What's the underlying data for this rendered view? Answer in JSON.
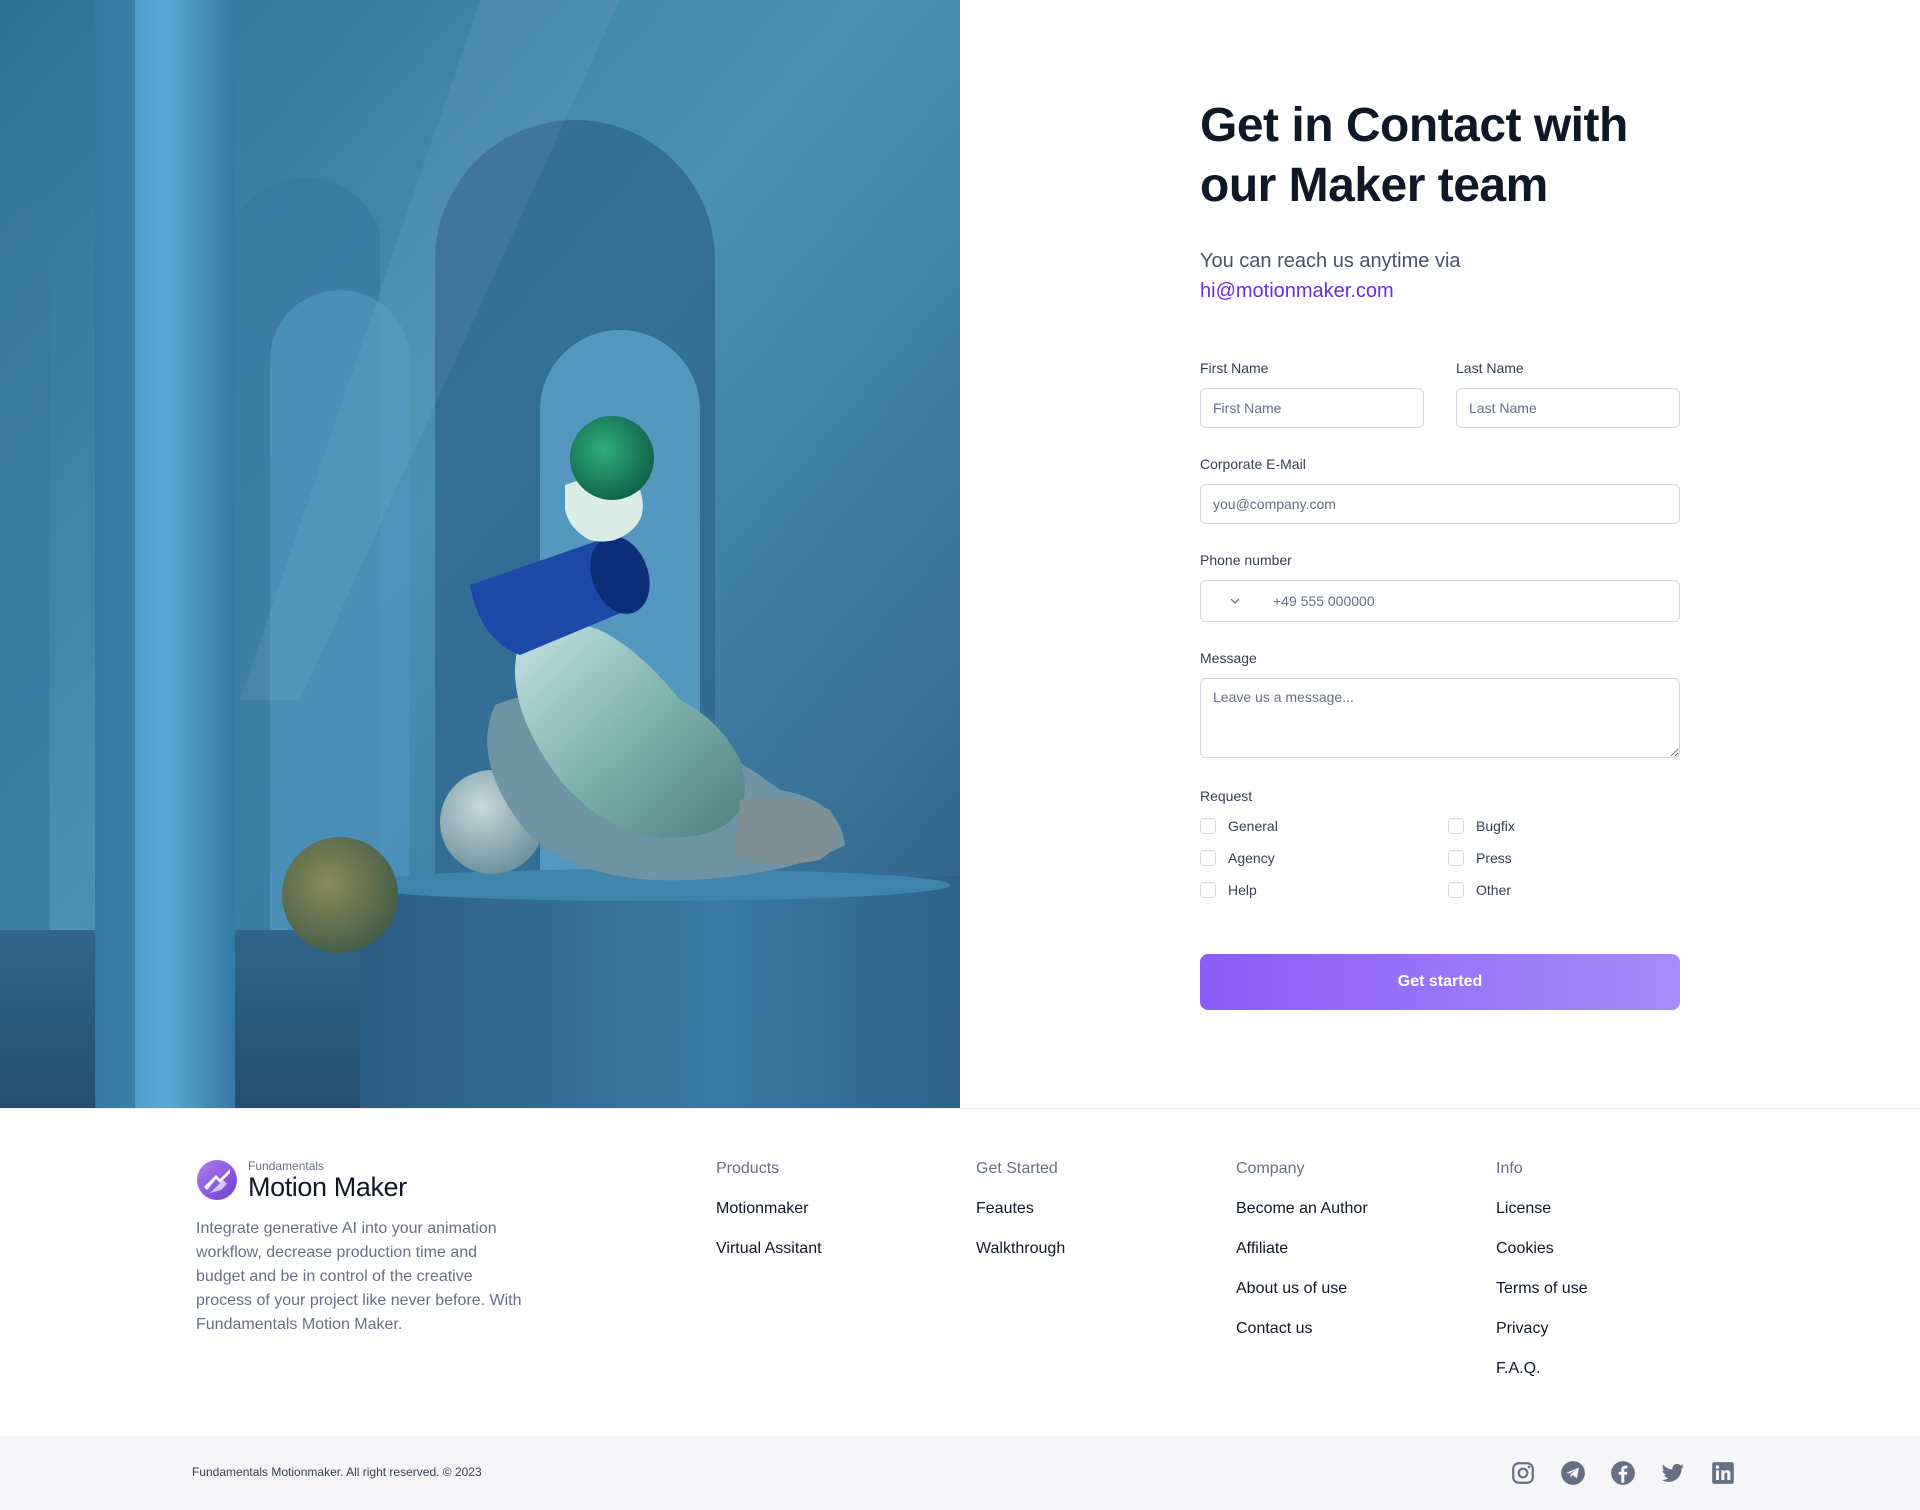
{
  "form": {
    "title": "Get in Contact with our Maker team",
    "intro_text": "You can reach us anytime via",
    "email": "hi@motionmaker.com",
    "first_name": {
      "label": "First Name",
      "placeholder": "First Name",
      "value": ""
    },
    "last_name": {
      "label": "Last Name",
      "placeholder": "Last Name",
      "value": ""
    },
    "corporate_email": {
      "label": "Corporate E-Mail",
      "placeholder": "you@company.com",
      "value": ""
    },
    "phone": {
      "label": "Phone number",
      "placeholder": "+49 555 000000",
      "value": ""
    },
    "message": {
      "label": "Message",
      "placeholder": "Leave us a message...",
      "value": ""
    },
    "request": {
      "label": "Request",
      "options": [
        {
          "label": "General",
          "checked": false
        },
        {
          "label": "Bugfix",
          "checked": false
        },
        {
          "label": "Agency",
          "checked": false
        },
        {
          "label": "Press",
          "checked": false
        },
        {
          "label": "Help",
          "checked": false
        },
        {
          "label": "Other",
          "checked": false
        }
      ]
    },
    "submit_label": "Get started"
  },
  "footer": {
    "brand_small": "Fundamentals",
    "brand_name": "Motion Maker",
    "description": "Integrate generative AI into your animation workflow, decrease production time and budget and be in control of the creative process of your project like never before. With Fundamentals Motion Maker.",
    "columns": [
      {
        "heading": "Products",
        "links": [
          "Motionmaker",
          "Virtual Assitant"
        ]
      },
      {
        "heading": "Get Started",
        "links": [
          "Feautes",
          "Walkthrough"
        ]
      },
      {
        "heading": "Company",
        "links": [
          "Become an Author",
          "Affiliate",
          "About us of use",
          "Contact us"
        ]
      },
      {
        "heading": "Info",
        "links": [
          "License",
          "Cookies",
          "Terms of use",
          "Privacy",
          "F.A.Q."
        ]
      }
    ],
    "copyright": "Fundamentals Motionmaker. All right reserved. © 2023",
    "social_icons": [
      "instagram-icon",
      "telegram-icon",
      "facebook-icon",
      "twitter-icon",
      "linkedin-icon"
    ]
  },
  "colors": {
    "accent": "#6e2bd9",
    "button_start": "#8b5cf6",
    "button_end": "#a78bfa",
    "hero_blue": "#3f7ea3"
  }
}
